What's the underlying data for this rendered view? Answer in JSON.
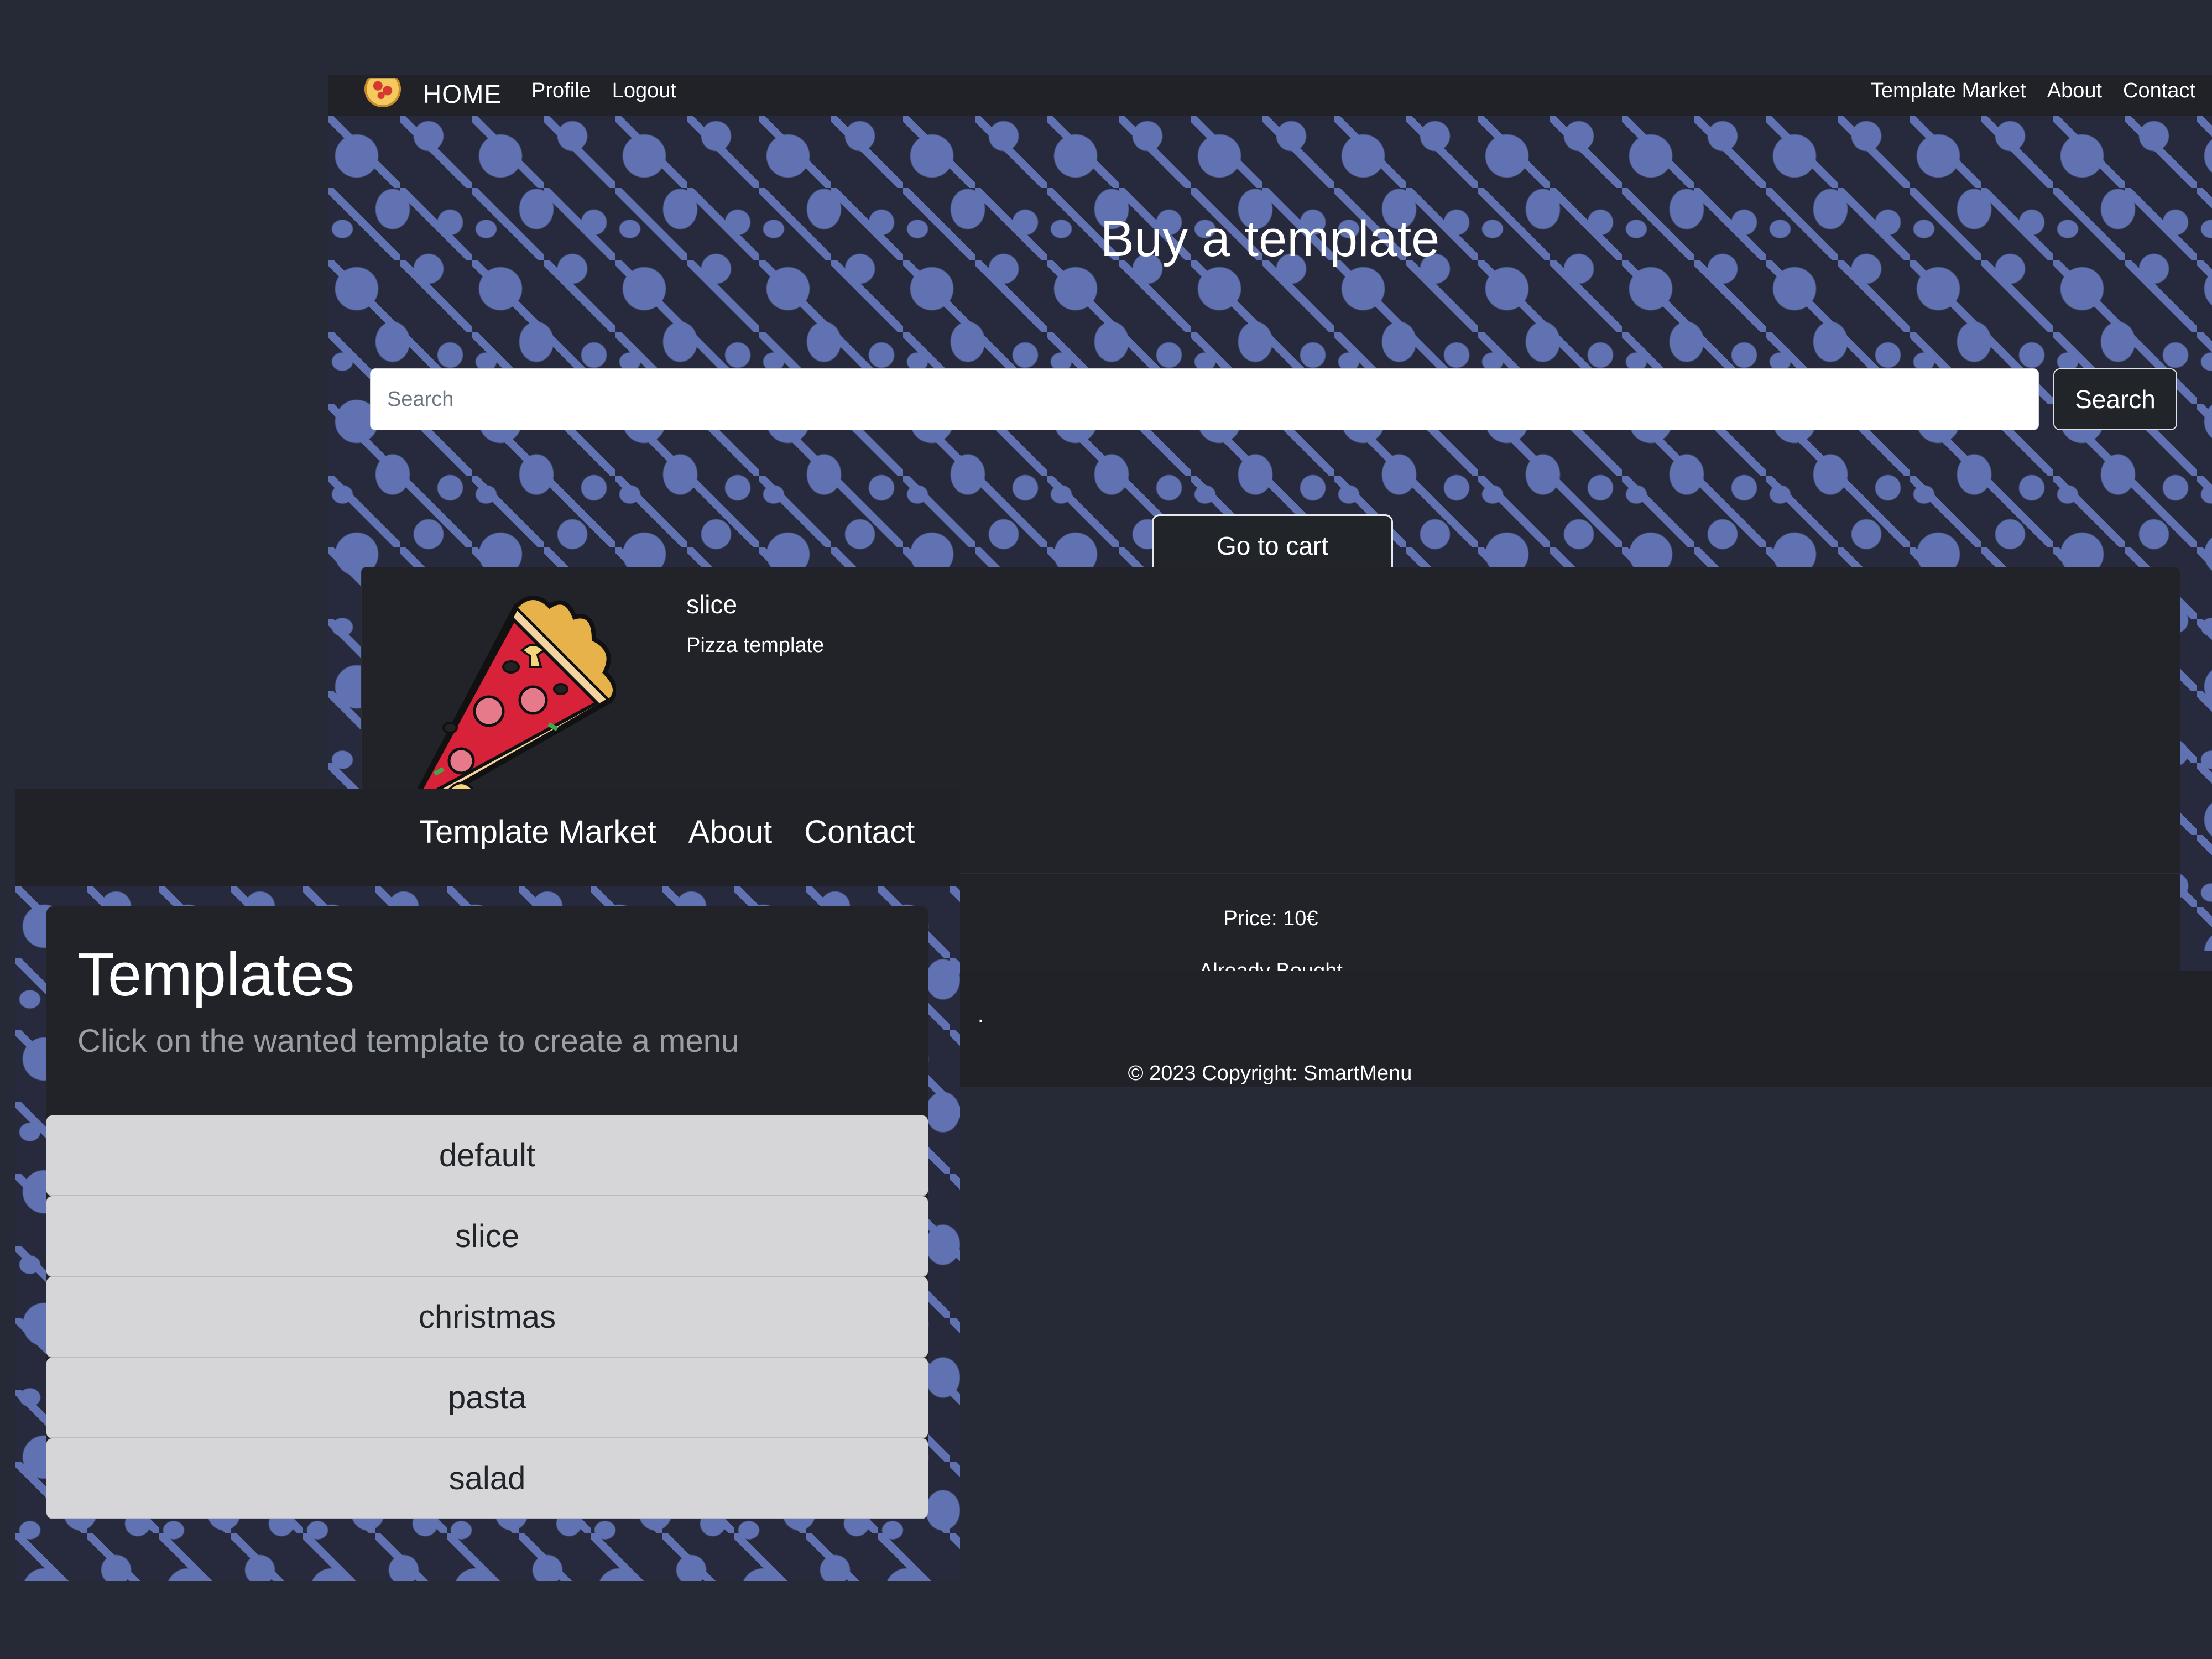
{
  "main": {
    "nav": {
      "brand": "HOME",
      "left_links": [
        "Profile",
        "Logout"
      ],
      "right_links": [
        "Template Market",
        "About",
        "Contact"
      ]
    },
    "hero": {
      "title": "Buy a template",
      "search_placeholder": "Search",
      "search_button": "Search",
      "cart_button": "Go to cart"
    },
    "card": {
      "title": "slice",
      "description": "Pizza template",
      "price": "Price: 10€",
      "status": "Already Bought"
    },
    "footer": {
      "dot": ".",
      "copyright": "© 2023 Copyright: SmartMenu"
    }
  },
  "overlay": {
    "nav_links": [
      "Template Market",
      "About",
      "Contact"
    ],
    "title": "Templates",
    "subtitle": "Click on the wanted template to create a menu",
    "templates": [
      "default",
      "slice",
      "christmas",
      "pasta",
      "salad"
    ]
  },
  "colors": {
    "background": "#262936",
    "pattern": "#6172b3",
    "navbar": "#202227",
    "card": "#212328",
    "list_item": "#d6d6d8"
  },
  "icons": {
    "brand": "pizza-logo-icon",
    "card_image": "pizza-slice-image"
  }
}
